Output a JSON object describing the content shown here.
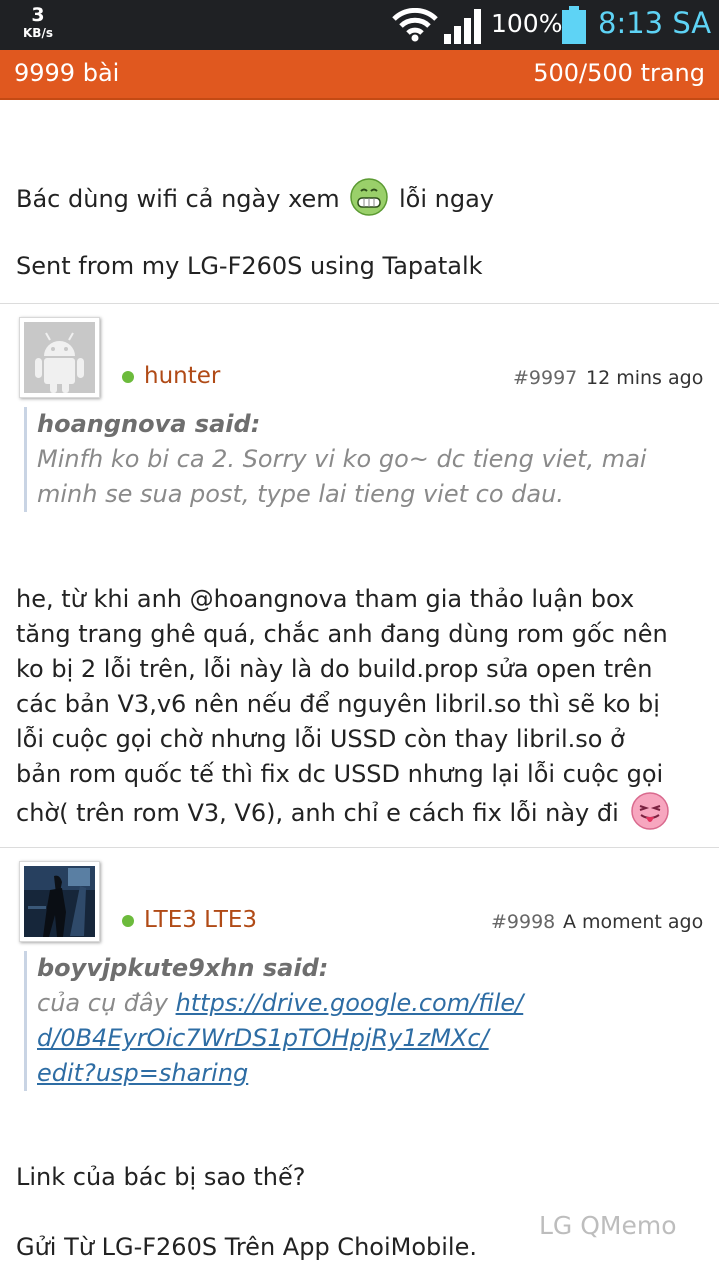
{
  "status_bar": {
    "speed_value": "3",
    "speed_unit": "KB/s",
    "battery_percent": "100%",
    "time": "8:13 SA",
    "wifi_icon": "wifi-icon",
    "signal_icon": "signal-icon",
    "battery_icon": "battery-icon"
  },
  "header": {
    "post_count": "9999 bài",
    "page_indicator": "500/500 trang",
    "bar_color": "#e0581f"
  },
  "posts": [
    {
      "body_line1_a": "Bác dùng wifi cả ngày xem",
      "emoji": "grin-emoji",
      "body_line1_b": "lỗi ngay",
      "signature": "Sent from my LG-F260S using Tapatalk"
    },
    {
      "username": "hunter",
      "post_number": "#9997",
      "time": "12 mins ago",
      "avatar_icon": "android-avatar-icon",
      "quote_author": "hoangnova said:",
      "quote_lines": [
        "Minfh ko bi ca 2. Sorry vi ko go~ dc tieng viet, mai",
        "minh se sua post, type lai tieng viet co dau."
      ],
      "body_lines": [
        "he, từ khi anh @hoangnova tham gia thảo luận box",
        "tăng trang ghê quá, chắc anh đang dùng rom gốc nên",
        "ko bị 2 lỗi trên, lỗi này là do build.prop sửa open trên",
        "các bản V3,v6 nên nếu để nguyên libril.so thì sẽ ko bị",
        "lỗi cuộc gọi chờ nhưng lỗi USSD còn thay libril.so ở",
        "bản rom quốc tế thì fix dc USSD nhưng lại lỗi cuộc gọi",
        "chờ( trên rom V3, V6), anh chỉ e cách fix lỗi này đi"
      ],
      "emoji": "tongue-emoji"
    },
    {
      "username": "LTE3 LTE3",
      "post_number": "#9998",
      "time": "A moment ago",
      "avatar_icon": "photo-avatar-icon",
      "quote_author": "boyvjpkute9xhn said:",
      "quote_prefix": "của cụ đây",
      "quote_link_lines": [
        "https://drive.google.com/file/",
        "d/0B4EyrOic7WrDS1pTOHpjRy1zMXc/",
        "edit?usp=sharing"
      ],
      "body_line": "Link của bác bị sao thế?",
      "signature": "Gửi Từ LG-F260S Trên App ChoiMobile."
    }
  ],
  "watermark": "LG QMemo",
  "status_dot_color": "#6cbb3c",
  "username_color": "#b04a16"
}
